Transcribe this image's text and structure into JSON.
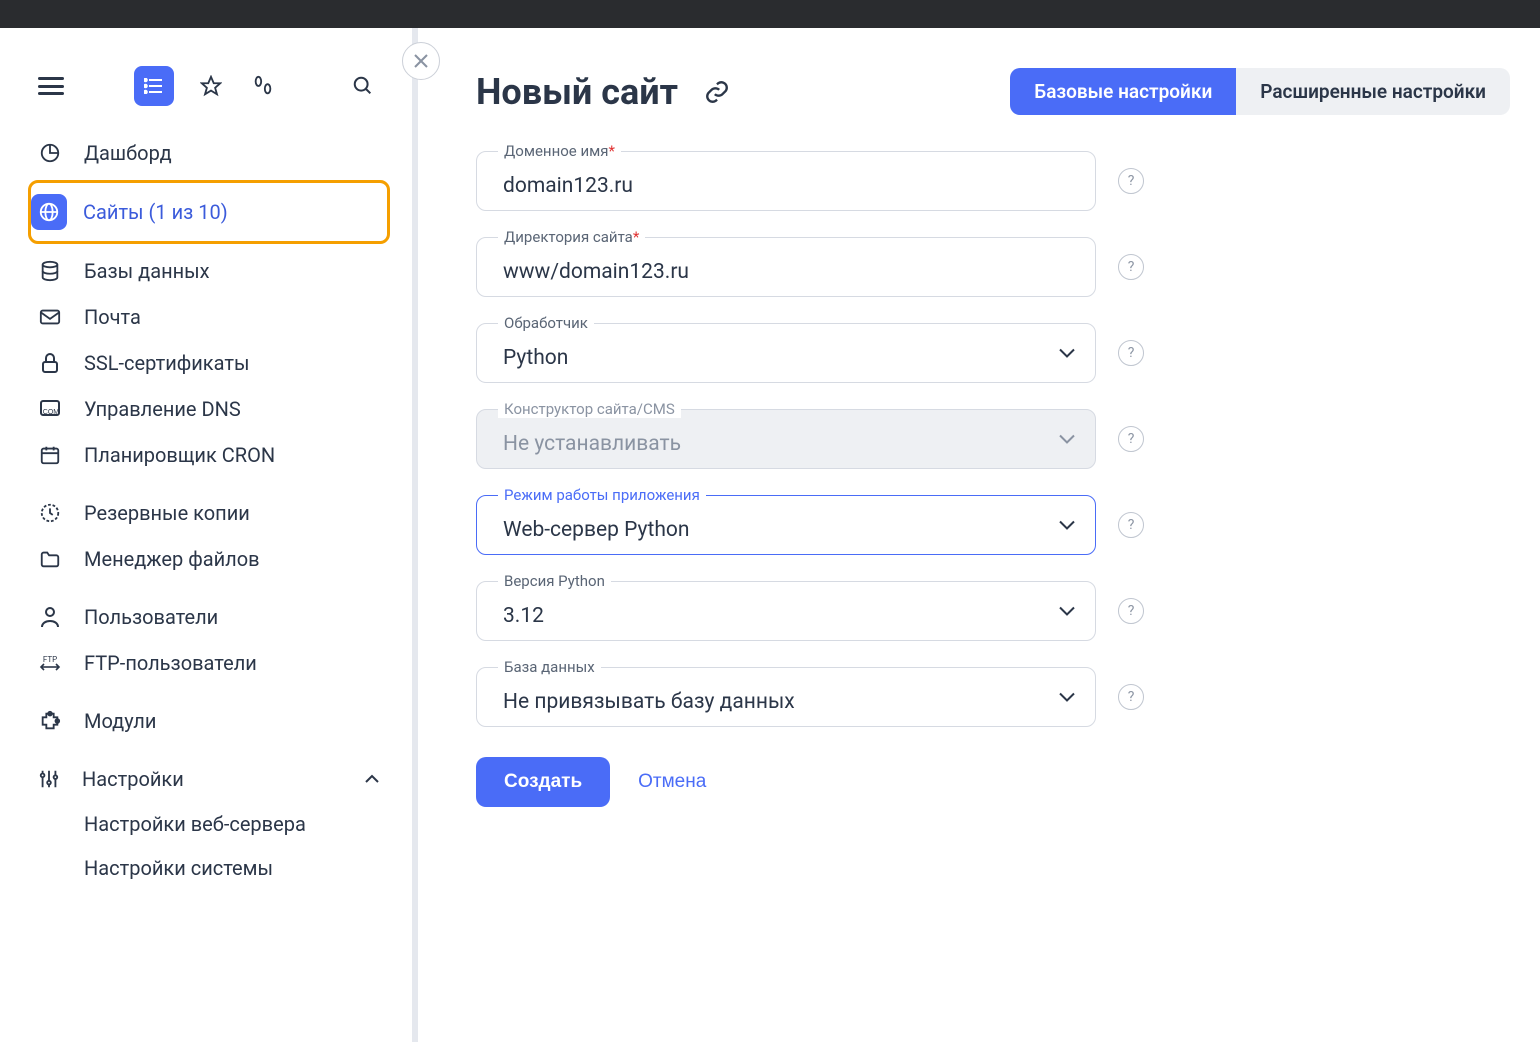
{
  "sidebar": {
    "items": [
      {
        "label": "Дашборд"
      },
      {
        "label": "Сайты (1 из 10)"
      },
      {
        "label": "Базы данных"
      },
      {
        "label": "Почта"
      },
      {
        "label": "SSL-сертификаты"
      },
      {
        "label": "Управление DNS"
      },
      {
        "label": "Планировщик CRON"
      },
      {
        "label": "Резервные копии"
      },
      {
        "label": "Менеджер файлов"
      },
      {
        "label": "Пользователи"
      },
      {
        "label": "FTP-пользователи"
      },
      {
        "label": "Модули"
      }
    ],
    "settings": {
      "label": "Настройки",
      "sub": [
        "Настройки веб-сервера",
        "Настройки системы"
      ]
    }
  },
  "page": {
    "title": "Новый сайт",
    "tabs": {
      "basic": "Базовые настройки",
      "advanced": "Расширенные настройки"
    }
  },
  "form": {
    "domain": {
      "label": "Доменное имя",
      "value": "domain123.ru"
    },
    "directory": {
      "label": "Директория сайта",
      "value": "www/domain123.ru"
    },
    "handler": {
      "label": "Обработчик",
      "value": "Python"
    },
    "cms": {
      "label": "Конструктор сайта/CMS",
      "value": "Не устанавливать"
    },
    "mode": {
      "label": "Режим работы приложения",
      "value": "Web-сервер Python"
    },
    "pyver": {
      "label": "Версия Python",
      "value": "3.12"
    },
    "db": {
      "label": "База данных",
      "value": "Не привязывать базу данных"
    }
  },
  "actions": {
    "create": "Создать",
    "cancel": "Отмена"
  }
}
